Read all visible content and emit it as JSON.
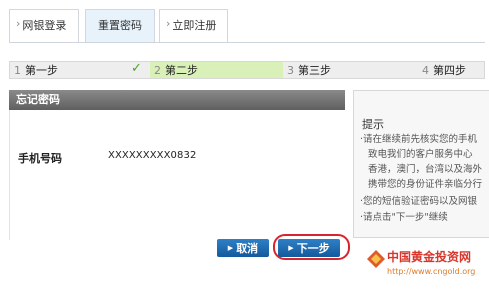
{
  "tabs": [
    {
      "label": "网银登录",
      "active": false
    },
    {
      "label": "重置密码",
      "active": true
    },
    {
      "label": "立即注册",
      "active": false
    }
  ],
  "steps": [
    {
      "num": "1",
      "label": "第一步",
      "done": true
    },
    {
      "num": "2",
      "label": "第二步",
      "current": true
    },
    {
      "num": "3",
      "label": "第三步"
    },
    {
      "num": "4",
      "label": "第四步"
    }
  ],
  "panel": {
    "title": "忘记密码",
    "phone_label": "手机号码",
    "phone_value": "XXXXXXXXX0832",
    "cancel_label": "取消",
    "next_label": "下一步"
  },
  "tips": {
    "title": "提示",
    "lines": [
      "·请在继续前先核实您的手机",
      "致电我们的客户服务中心",
      "香港，澳门，台湾以及海外",
      "携带您的身份证件亲临分行",
      "·您的短信验证密码以及网银",
      "·请点击\"下一步\"继续"
    ]
  },
  "watermark": {
    "name": "中国黄金投资网",
    "url": "http://www.cngold.org"
  },
  "colors": {
    "accent_blue": "#1f6fb5",
    "step_current": "#d9f1b8",
    "highlight_red": "#d7252c",
    "check_green": "#4aa228"
  }
}
